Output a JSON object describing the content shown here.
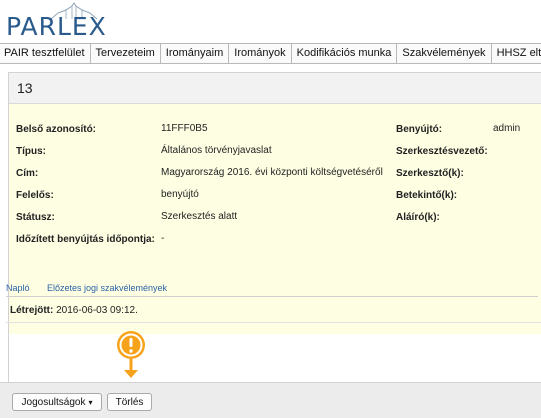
{
  "app": {
    "logo_text": "PARLEX"
  },
  "nav": {
    "items": [
      "PAIR tesztfelület",
      "Tervezeteim",
      "Irományaim",
      "Irományok",
      "Kodifikációs munka",
      "Szakvélemények",
      "HHSZ eltérés"
    ]
  },
  "record": {
    "title": "13",
    "fields_left": [
      {
        "label": "Belső azonosító:",
        "value": "11FFF0B5"
      },
      {
        "label": "Típus:",
        "value": "Általános törvényjavaslat"
      },
      {
        "label": "Cím:",
        "value": "Magyarország 2016. évi központi költségvetéséről"
      },
      {
        "label": "Felelős:",
        "value": "benyújtó"
      },
      {
        "label": "Státusz:",
        "value": "Szerkesztés alatt"
      },
      {
        "label": "Időzített benyújtás időpontja:",
        "value": "-"
      }
    ],
    "fields_right": [
      {
        "label": "Benyújtó:",
        "value": "admin"
      },
      {
        "label": "Szerkesztésvezető:",
        "value": ""
      },
      {
        "label": "Szerkesztő(k):",
        "value": ""
      },
      {
        "label": "Betekintő(k):",
        "value": ""
      },
      {
        "label": "Aláíró(k):",
        "value": ""
      }
    ]
  },
  "tabs": {
    "items": [
      "Napló",
      "Előzetes jogi szakvélemények"
    ],
    "active": "Napló"
  },
  "log": {
    "label": "Létrejött:",
    "value": "2016-06-03 09:12."
  },
  "footer": {
    "permissions_label": "Jogosultságok",
    "delete_label": "Törlés"
  },
  "colors": {
    "accent": "#f7a21b",
    "link": "#2a63a6",
    "details_bg": "#fefee3"
  },
  "icons": {
    "marker": "exclamation-marker-icon",
    "dropdown": "chevron-down-icon"
  }
}
